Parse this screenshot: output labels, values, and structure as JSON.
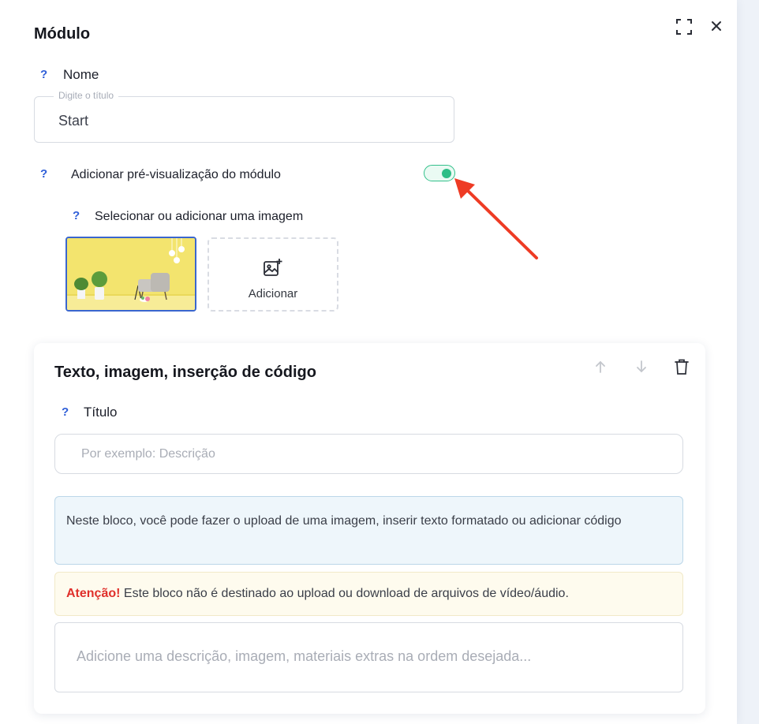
{
  "modal": {
    "title": "Módulo",
    "name_help": "?",
    "name_label": "Nome",
    "title_field": {
      "float_label": "Digite o título",
      "value": "Start"
    },
    "preview_help": "?",
    "preview_label": "Adicionar pré-visualização do módulo",
    "preview_enabled": true,
    "image_help": "?",
    "image_label": "Selecionar ou adicionar uma imagem",
    "add_image_label": "Adicionar"
  },
  "block": {
    "title": "Texto, imagem, inserção de código",
    "field_help": "?",
    "field_label": "Título",
    "field_placeholder": "Por exemplo: Descrição",
    "info_text": "Neste bloco, você pode fazer o upload de uma imagem, inserir texto formatado ou adicionar código",
    "warning_strong": "Atenção!",
    "warning_text": " Este bloco não é destinado ao upload ou download de arquivos de vídeo/áudio.",
    "description_placeholder": "Adicione uma descrição, imagem, materiais extras na ordem desejada..."
  },
  "colors": {
    "accent_blue": "#2f5fd8",
    "toggle_green": "#2ebd86",
    "warning_red": "#e0302b",
    "annotation_arrow": "#ee3b24"
  },
  "icons": [
    "expand-icon",
    "close-icon",
    "add-image-icon",
    "arrow-up-icon",
    "arrow-down-icon",
    "trash-icon"
  ]
}
